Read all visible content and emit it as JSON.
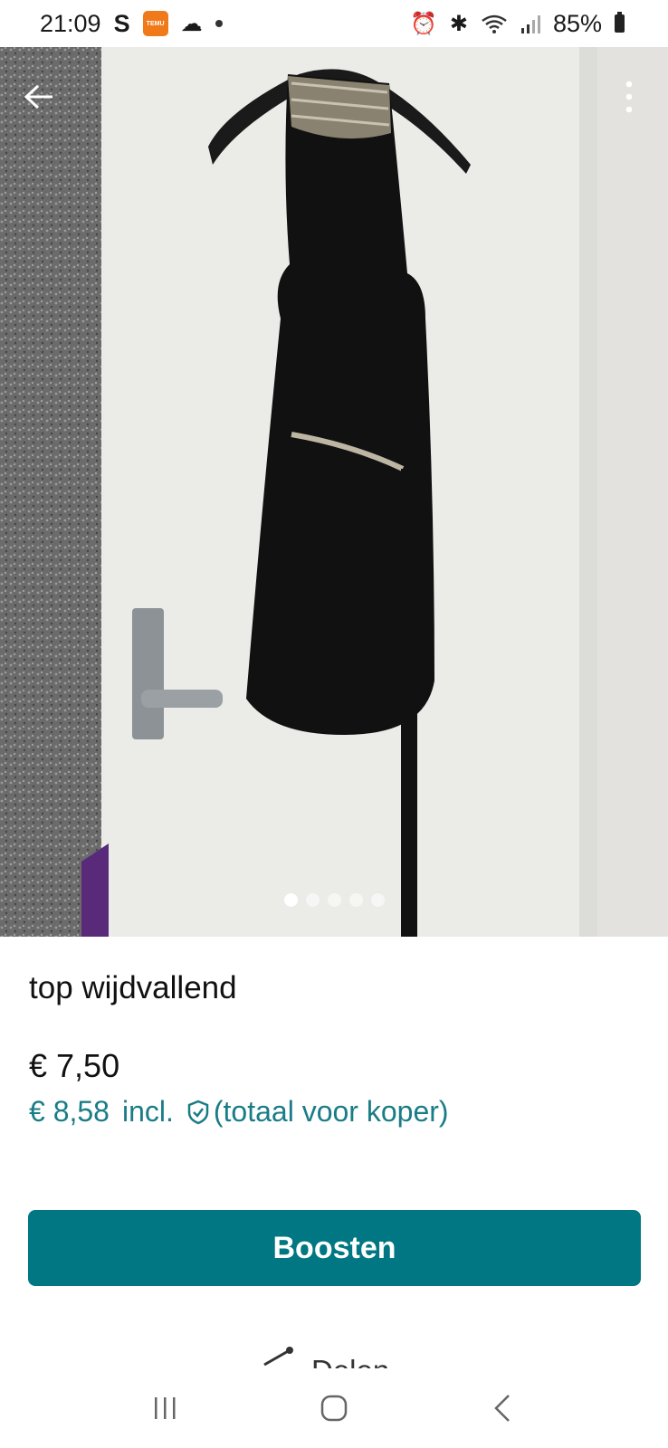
{
  "status_bar": {
    "time": "21:09",
    "s_label": "S",
    "temu_label": "TEMU",
    "battery": "85%",
    "icons": [
      "cloud-icon",
      "alarm-icon",
      "bluetooth-icon",
      "wifi-icon",
      "signal-icon",
      "battery-icon"
    ]
  },
  "gallery": {
    "photo_count": 5,
    "active_index": 0,
    "back_icon": "arrow-left-icon",
    "more_icon": "more-vertical-icon"
  },
  "item": {
    "title": "top wijdvallend",
    "price": "€ 7,50",
    "price_incl": "€ 8,58",
    "incl_label": "incl.",
    "incl_note": "(totaal voor koper)"
  },
  "actions": {
    "boost_label": "Boosten",
    "share_label": "Delen"
  },
  "colors": {
    "accent": "#007782",
    "accent_text": "#1a7c86"
  },
  "nav_bar": {
    "icons": [
      "recents-icon",
      "home-icon",
      "back-icon"
    ]
  }
}
